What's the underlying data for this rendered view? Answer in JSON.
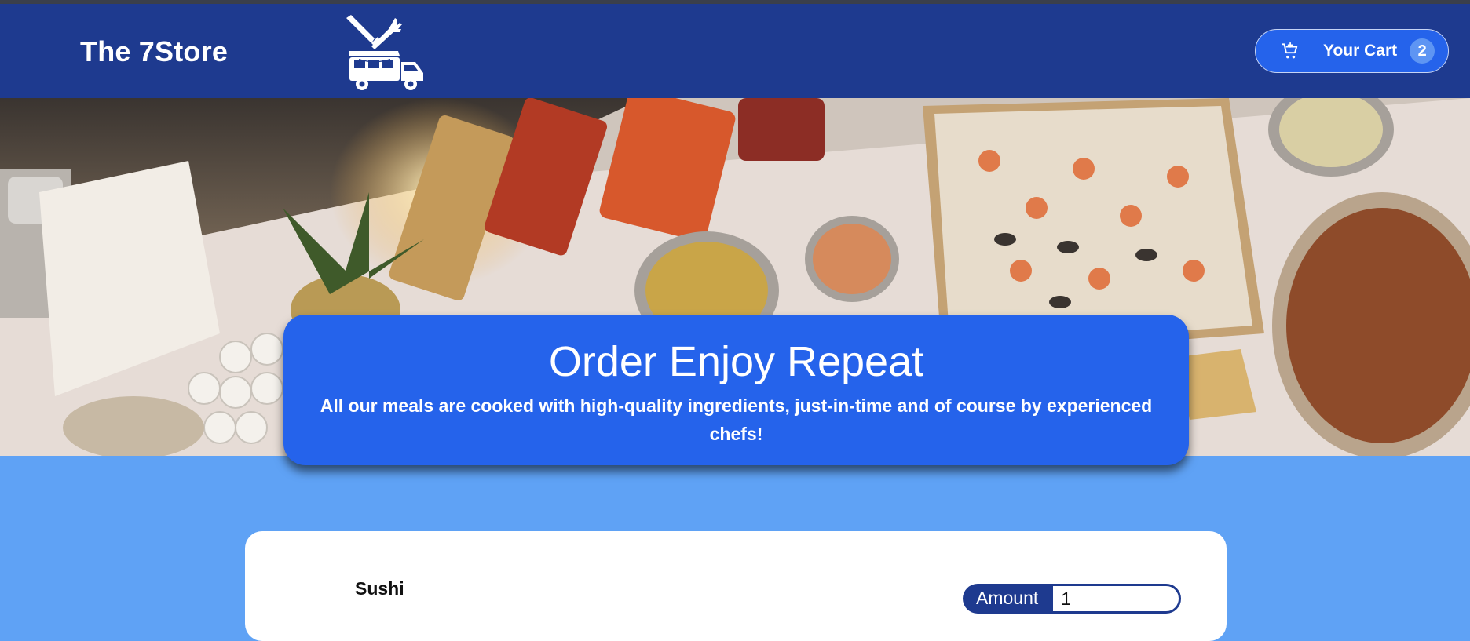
{
  "header": {
    "brand": "The 7Store",
    "logo_icon": "food-truck-icon",
    "cart": {
      "label": "Your Cart",
      "count": "2",
      "icon": "cart-icon"
    }
  },
  "hero": {
    "image": "catering-buffet-photo"
  },
  "banner": {
    "title": "Order Enjoy Repeat",
    "subtitle": "All our meals are cooked with high-quality ingredients, just-in-time and of course by experienced chefs!"
  },
  "meals": [
    {
      "name": "Sushi",
      "amount_label": "Amount",
      "amount_value": "1"
    }
  ],
  "colors": {
    "header": "#1e3a8f",
    "accent": "#2563eb",
    "page_bg": "#5fa2f5",
    "badge": "#5e95f3"
  }
}
